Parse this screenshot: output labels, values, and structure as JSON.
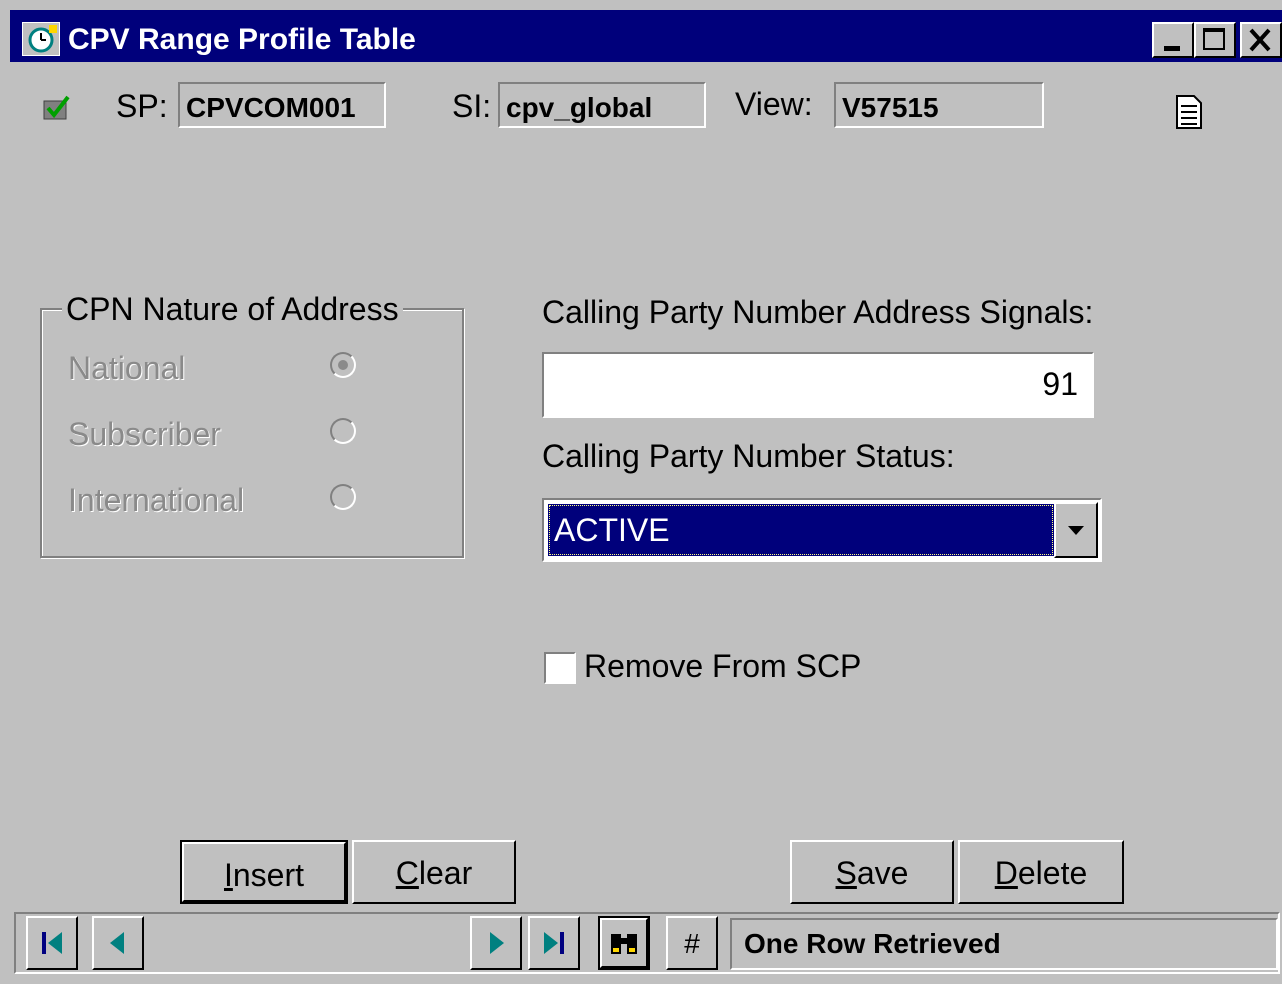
{
  "window": {
    "title": "CPV Range Profile Table"
  },
  "header": {
    "sp_label": "SP:",
    "sp_value": "CPVCOM001",
    "si_label": "SI:",
    "si_value": "cpv_global",
    "view_label": "View:",
    "view_value": "V57515"
  },
  "nature": {
    "title": "CPN Nature of Address",
    "options": [
      "National",
      "Subscriber",
      "International"
    ],
    "selected": "National"
  },
  "signals": {
    "label": "Calling Party Number Address Signals:",
    "value": "91"
  },
  "status": {
    "label": "Calling Party Number Status:",
    "value": "ACTIVE"
  },
  "remove": {
    "label": "Remove From SCP",
    "checked": false
  },
  "buttons": {
    "insert_rest": "nsert",
    "insert_key": "I",
    "clear_key": "C",
    "clear_rest": "lear",
    "save_key": "S",
    "save_rest": "ave",
    "delete_key": "D",
    "delete_rest": "elete"
  },
  "navbar": {
    "hash": "#",
    "status_text": "One Row Retrieved"
  },
  "colors": {
    "title_bar": "#00007b",
    "selection": "#00007b",
    "face": "#c0c0c0"
  }
}
